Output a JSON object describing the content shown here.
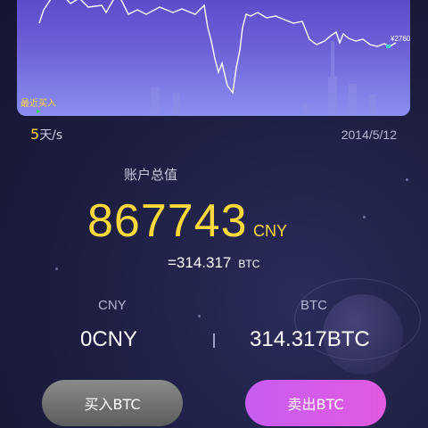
{
  "chart": {
    "latest_price": "¥2760.7",
    "recent_buy_label": "最近买入",
    "line_color": "#ffffff",
    "marker_color": "#39d6c9"
  },
  "meta": {
    "speed_value": "5",
    "speed_unit": "天/s",
    "date": "2014/5/12"
  },
  "account": {
    "title": "账户总值",
    "total_value": "867743",
    "total_unit": "CNY",
    "btc_equiv": "=314.317",
    "btc_unit": "BTC"
  },
  "balances": {
    "cny_label": "CNY",
    "cny_value": "0CNY",
    "btc_label": "BTC",
    "btc_value": "314.317BTC"
  },
  "actions": {
    "buy_label": "买入BTC",
    "sell_label": "卖出BTC"
  },
  "colors": {
    "accent_yellow": "#ffd93a",
    "sell_button": "#d95ce8",
    "buy_button": "#707070"
  }
}
